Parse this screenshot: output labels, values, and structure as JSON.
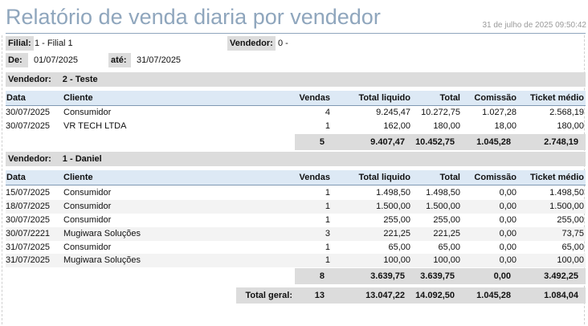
{
  "report": {
    "title": "Relatório de venda diaria por vendedor",
    "generated_at": "31 de julho de 2025 09:50:42"
  },
  "filters": {
    "filial_label": "Filial:",
    "filial_value": "1 - Filial 1",
    "vendedor_label": "Vendedor:",
    "vendedor_value": "0 -",
    "de_label": "De:",
    "de_value": "01/07/2025",
    "ate_label": "até:",
    "ate_value": "31/07/2025"
  },
  "columns": {
    "data": "Data",
    "cliente": "Cliente",
    "vendas": "Vendas",
    "total_liquido": "Total liquido",
    "total": "Total",
    "comissao": "Comissão",
    "ticket_medio": "Ticket médio"
  },
  "groups": [
    {
      "label": "Vendedor:",
      "name": "2 - Teste",
      "rows": [
        {
          "data": "30/07/2025",
          "cliente": "Consumidor",
          "vendas": "4",
          "total_liquido": "9.245,47",
          "total": "10.272,75",
          "comissao": "1.027,28",
          "ticket_medio": "2.568,19"
        },
        {
          "data": "30/07/2025",
          "cliente": "VR TECH LTDA",
          "vendas": "1",
          "total_liquido": "162,00",
          "total": "180,00",
          "comissao": "18,00",
          "ticket_medio": "180,00"
        }
      ],
      "totals": {
        "vendas": "5",
        "total_liquido": "9.407,47",
        "total": "10.452,75",
        "comissao": "1.045,28",
        "ticket_medio": "2.748,19"
      }
    },
    {
      "label": "Vendedor:",
      "name": "1 - Daniel",
      "rows": [
        {
          "data": "15/07/2025",
          "cliente": "Consumidor",
          "vendas": "1",
          "total_liquido": "1.498,50",
          "total": "1.498,50",
          "comissao": "0,00",
          "ticket_medio": "1.498,50"
        },
        {
          "data": "18/07/2025",
          "cliente": "Consumidor",
          "vendas": "1",
          "total_liquido": "1.500,00",
          "total": "1.500,00",
          "comissao": "0,00",
          "ticket_medio": "1.500,00"
        },
        {
          "data": "30/07/2025",
          "cliente": "Consumidor",
          "vendas": "1",
          "total_liquido": "255,00",
          "total": "255,00",
          "comissao": "0,00",
          "ticket_medio": "255,00"
        },
        {
          "data": "30/07/2221",
          "cliente": "Mugiwara Soluções",
          "vendas": "3",
          "total_liquido": "221,25",
          "total": "221,25",
          "comissao": "0,00",
          "ticket_medio": "73,75"
        },
        {
          "data": "31/07/2025",
          "cliente": "Consumidor",
          "vendas": "1",
          "total_liquido": "65,00",
          "total": "65,00",
          "comissao": "0,00",
          "ticket_medio": "65,00"
        },
        {
          "data": "31/07/2025",
          "cliente": "Mugiwara Soluções",
          "vendas": "1",
          "total_liquido": "100,00",
          "total": "100,00",
          "comissao": "0,00",
          "ticket_medio": "100,00"
        }
      ],
      "totals": {
        "vendas": "8",
        "total_liquido": "3.639,75",
        "total": "3.639,75",
        "comissao": "0,00",
        "ticket_medio": "3.492,25"
      }
    }
  ],
  "grand_total": {
    "label": "Total geral:",
    "vendas": "13",
    "total_liquido": "13.047,22",
    "total": "14.092,50",
    "comissao": "1.045,28",
    "ticket_medio": "1.084,04"
  }
}
